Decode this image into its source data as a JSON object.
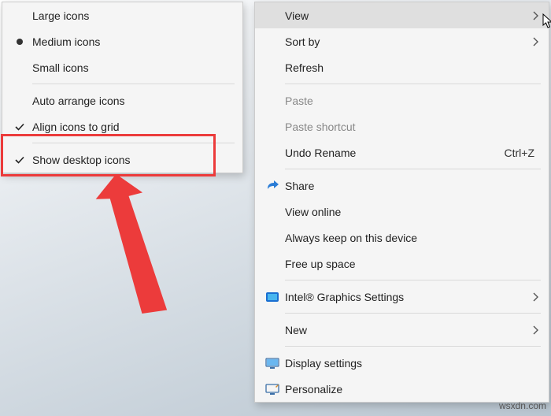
{
  "submenu": {
    "items": [
      {
        "label": "Large icons",
        "mark": ""
      },
      {
        "label": "Medium icons",
        "mark": "bullet"
      },
      {
        "label": "Small icons",
        "mark": ""
      },
      {
        "label": "Auto arrange icons",
        "mark": ""
      },
      {
        "label": "Align icons to grid",
        "mark": "check"
      },
      {
        "label": "Show desktop icons",
        "mark": "check"
      }
    ]
  },
  "mainmenu": {
    "items": [
      {
        "label": "View",
        "icon": "",
        "submenu": true,
        "highlight": true
      },
      {
        "label": "Sort by",
        "icon": "",
        "submenu": true
      },
      {
        "label": "Refresh",
        "icon": ""
      },
      {
        "label": "Paste",
        "icon": "",
        "disabled": true
      },
      {
        "label": "Paste shortcut",
        "icon": "",
        "disabled": true
      },
      {
        "label": "Undo Rename",
        "icon": "",
        "shortcut": "Ctrl+Z"
      },
      {
        "label": "Share",
        "icon": "share"
      },
      {
        "label": "View online",
        "icon": ""
      },
      {
        "label": "Always keep on this device",
        "icon": ""
      },
      {
        "label": "Free up space",
        "icon": ""
      },
      {
        "label": "Intel® Graphics Settings",
        "icon": "intel",
        "submenu": true
      },
      {
        "label": "New",
        "icon": "",
        "submenu": true
      },
      {
        "label": "Display settings",
        "icon": "display"
      },
      {
        "label": "Personalize",
        "icon": "personalize"
      }
    ]
  },
  "watermark": "wsxdn.com"
}
